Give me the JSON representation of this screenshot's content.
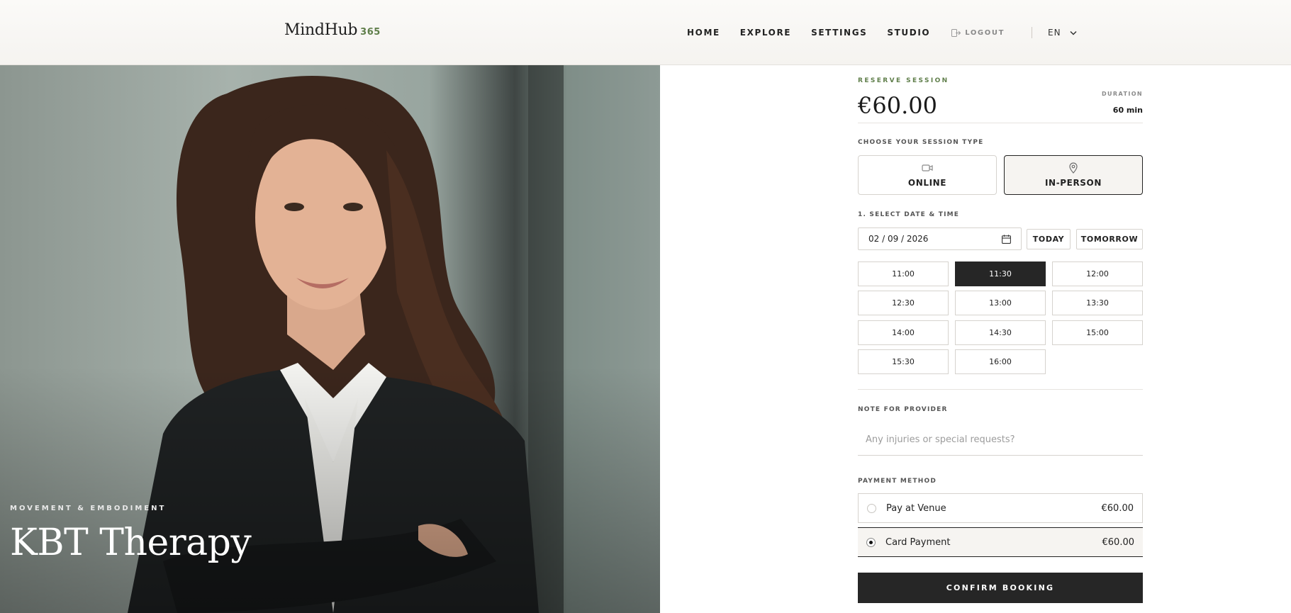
{
  "header": {
    "brand_name": "MindHub",
    "brand_suffix": "365",
    "nav": [
      "HOME",
      "EXPLORE",
      "SETTINGS",
      "STUDIO"
    ],
    "logout_label": "LOGOUT",
    "language": "EN"
  },
  "hero": {
    "eyebrow": "MOVEMENT & EMBODIMENT",
    "title": "KBT Therapy"
  },
  "booking": {
    "eyebrow": "RESERVE SESSION",
    "price": "€60.00",
    "duration_label": "DURATION",
    "duration_value": "60 min",
    "session_type_label": "CHOOSE YOUR SESSION TYPE",
    "session_types": [
      {
        "label": "ONLINE",
        "icon": "video-camera-icon",
        "selected": false
      },
      {
        "label": "IN-PERSON",
        "icon": "map-pin-icon",
        "selected": true
      }
    ],
    "date_time_label": "1. SELECT DATE & TIME",
    "date_value": "02 / 09 / 2026",
    "today_label": "TODAY",
    "tomorrow_label": "TOMORROW",
    "time_slots": [
      "11:00",
      "11:30",
      "12:00",
      "12:30",
      "13:00",
      "13:30",
      "14:00",
      "14:30",
      "15:00",
      "15:30",
      "16:00"
    ],
    "selected_slot": "11:30",
    "note_label": "NOTE FOR PROVIDER",
    "note_placeholder": "Any injuries or special requests?",
    "payment_label": "PAYMENT METHOD",
    "payment_methods": [
      {
        "label": "Pay at Venue",
        "price": "€60.00",
        "selected": false
      },
      {
        "label": "Card Payment",
        "price": "€60.00",
        "selected": true
      }
    ],
    "confirm_label": "CONFIRM BOOKING"
  },
  "colors": {
    "accent_green": "#5f7e4a",
    "dark_button": "#262626",
    "selected_bg": "#f6f4f1"
  }
}
